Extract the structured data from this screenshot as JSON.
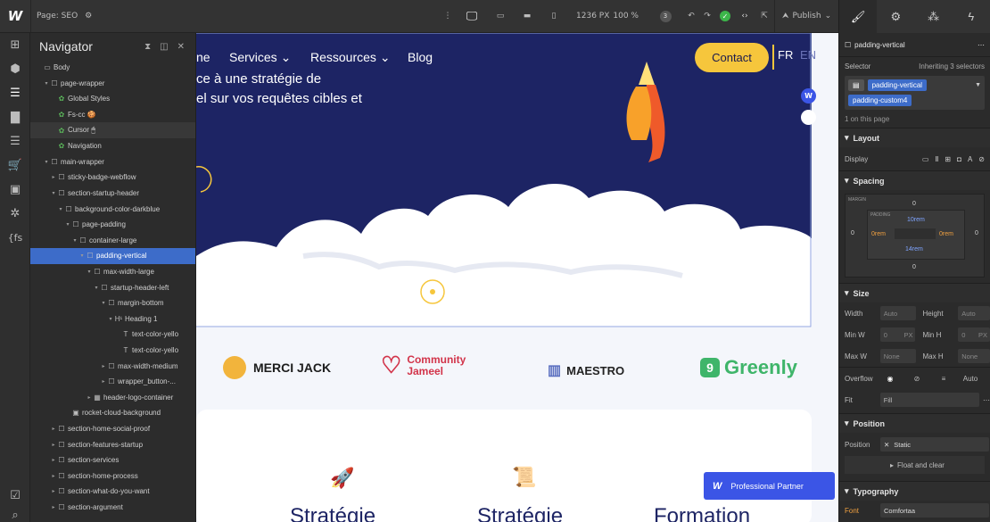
{
  "topbar": {
    "logo": "W",
    "page_label": "Page: SEO",
    "canvas_size": "1236 PX",
    "zoom": "100 %",
    "badge_count": "3",
    "publish_label": "Publish"
  },
  "navigator": {
    "title": "Navigator",
    "rows": [
      {
        "label": "Body",
        "depth": 0,
        "glyph": "▭",
        "caret": ""
      },
      {
        "label": "page-wrapper",
        "depth": 1,
        "glyph": "☐",
        "caret": "▾"
      },
      {
        "label": "Global Styles",
        "depth": 2,
        "glyph": "✿",
        "caret": "",
        "green": true
      },
      {
        "label": "Fs-cc 🍪",
        "depth": 2,
        "glyph": "✿",
        "caret": "",
        "green": true
      },
      {
        "label": "Cursor 🖱",
        "depth": 2,
        "glyph": "✿",
        "caret": "",
        "green": true,
        "hl": true
      },
      {
        "label": "Navigation",
        "depth": 2,
        "glyph": "✿",
        "caret": "",
        "green": true
      },
      {
        "label": "main-wrapper",
        "depth": 1,
        "glyph": "☐",
        "caret": "▾"
      },
      {
        "label": "sticky-badge-webflow",
        "depth": 2,
        "glyph": "☐",
        "caret": "▸"
      },
      {
        "label": "section-startup-header",
        "depth": 2,
        "glyph": "☐",
        "caret": "▾"
      },
      {
        "label": "background-color-darkblue",
        "depth": 3,
        "glyph": "☐",
        "caret": "▾"
      },
      {
        "label": "page-padding",
        "depth": 4,
        "glyph": "☐",
        "caret": "▾"
      },
      {
        "label": "container-large",
        "depth": 5,
        "glyph": "☐",
        "caret": "▾"
      },
      {
        "label": "padding-vertical",
        "depth": 6,
        "glyph": "☐",
        "caret": "▾",
        "sel": true
      },
      {
        "label": "max-width-large",
        "depth": 7,
        "glyph": "☐",
        "caret": "▾"
      },
      {
        "label": "startup-header-left",
        "depth": 8,
        "glyph": "☐",
        "caret": "▾"
      },
      {
        "label": "margin-bottom",
        "depth": 9,
        "glyph": "☐",
        "caret": "▾"
      },
      {
        "label": "Heading 1",
        "depth": 10,
        "glyph": "H¹",
        "caret": "▾"
      },
      {
        "label": "text-color-yello",
        "depth": 11,
        "glyph": "T",
        "caret": ""
      },
      {
        "label": "text-color-yello",
        "depth": 11,
        "glyph": "T",
        "caret": ""
      },
      {
        "label": "max-width-medium",
        "depth": 9,
        "glyph": "☐",
        "caret": "▸"
      },
      {
        "label": "wrapper_button-...",
        "depth": 9,
        "glyph": "☐",
        "caret": "▸"
      },
      {
        "label": "header-logo-container",
        "depth": 7,
        "glyph": "▦",
        "caret": "▸"
      },
      {
        "label": "rocket-cloud-background",
        "depth": 4,
        "glyph": "▣",
        "caret": ""
      },
      {
        "label": "section-home-social-proof",
        "depth": 2,
        "glyph": "☐",
        "caret": "▸"
      },
      {
        "label": "section-features-startup",
        "depth": 2,
        "glyph": "☐",
        "caret": "▸"
      },
      {
        "label": "section-services",
        "depth": 2,
        "glyph": "☐",
        "caret": "▸"
      },
      {
        "label": "section-home-process",
        "depth": 2,
        "glyph": "☐",
        "caret": "▸"
      },
      {
        "label": "section-what-do-you-want",
        "depth": 2,
        "glyph": "☐",
        "caret": "▸"
      },
      {
        "label": "section-argument",
        "depth": 2,
        "glyph": "☐",
        "caret": "▸"
      }
    ]
  },
  "site": {
    "nav_fragment": "ne",
    "nav_services": "Services",
    "nav_resources": "Ressources",
    "nav_blog": "Blog",
    "contact": "Contact",
    "lang_fr": "FR",
    "lang_en": "EN",
    "hero_line1": "ce à une stratégie de",
    "hero_line2": "el sur vos requêtes cibles et",
    "logos": [
      "MERCI JACK",
      "Community",
      "Jameel",
      "MAESTRO",
      "Greenly"
    ],
    "cards": [
      "Stratégie",
      "Stratégie",
      "Formation"
    ],
    "partner_badge": "Professional Partner",
    "partner_w": "W"
  },
  "panel": {
    "element_name": "padding-vertical",
    "selector_label": "Selector",
    "inheriting": "Inheriting 3 selectors",
    "chip1": "padding-vertical",
    "chip2": "padding-custom4",
    "on_page": "1 on this page",
    "layout": "Layout",
    "display": "Display",
    "spacing": "Spacing",
    "margin": "MARGIN",
    "padding": "PADDING",
    "margin_top": "0",
    "margin_left": "0",
    "margin_right": "0",
    "margin_bottom": "0",
    "padding_top": "10rem",
    "padding_left": "0rem",
    "padding_right": "0rem",
    "padding_bottom": "14rem",
    "size": "Size",
    "width": "Width",
    "height": "Height",
    "auto": "Auto",
    "min_w": "Min W",
    "min_h": "Min H",
    "max_w": "Max W",
    "max_h": "Max H",
    "zero": "0",
    "px": "PX",
    "none": "None",
    "overflow": "Overflow",
    "fit": "Fit",
    "fill": "Fill",
    "position_sec": "Position",
    "position": "Position",
    "static": "Static",
    "float_clear": "Float and clear",
    "typography": "Typography",
    "font": "Font",
    "font_value": "Comfortaa"
  }
}
